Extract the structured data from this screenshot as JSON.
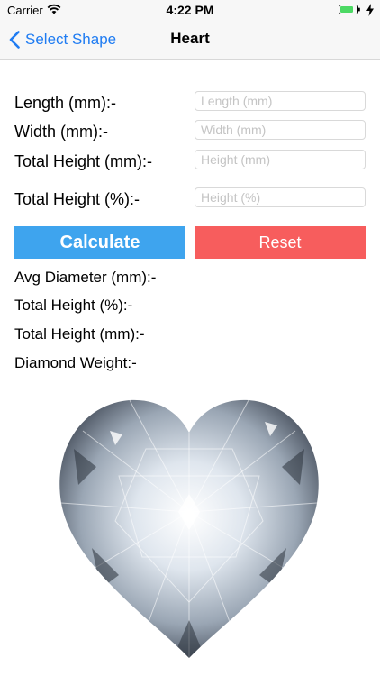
{
  "status_bar": {
    "carrier": "Carrier",
    "time": "4:22 PM",
    "wifi_icon": "wifi-icon",
    "battery_icon": "battery-icon",
    "battery_color": "#4cd964"
  },
  "nav": {
    "back_label": "Select Shape",
    "title": "Heart",
    "back_icon": "chevron-left-icon",
    "accent_color": "#1f7cf2"
  },
  "form": {
    "length": {
      "label": "Length (mm):-",
      "placeholder": "Length (mm)",
      "value": ""
    },
    "width": {
      "label": "Width (mm):-",
      "placeholder": "Width (mm)",
      "value": ""
    },
    "total_height_mm": {
      "label": "Total Height (mm):-",
      "placeholder": "Height (mm)",
      "value": ""
    },
    "total_height_pct": {
      "label": "Total Height (%):-",
      "placeholder": "Height (%)",
      "value": ""
    }
  },
  "buttons": {
    "calculate": "Calculate",
    "reset": "Reset",
    "calculate_color": "#3ea4ee",
    "reset_color": "#f75d5d"
  },
  "results": {
    "avg_diameter": "Avg Diameter (mm):-",
    "total_height_pct": "Total Height (%):-",
    "total_height_mm": "Total Height (mm):-",
    "diamond_weight": "Diamond Weight:-"
  },
  "image": {
    "icon": "heart-diamond-image"
  }
}
